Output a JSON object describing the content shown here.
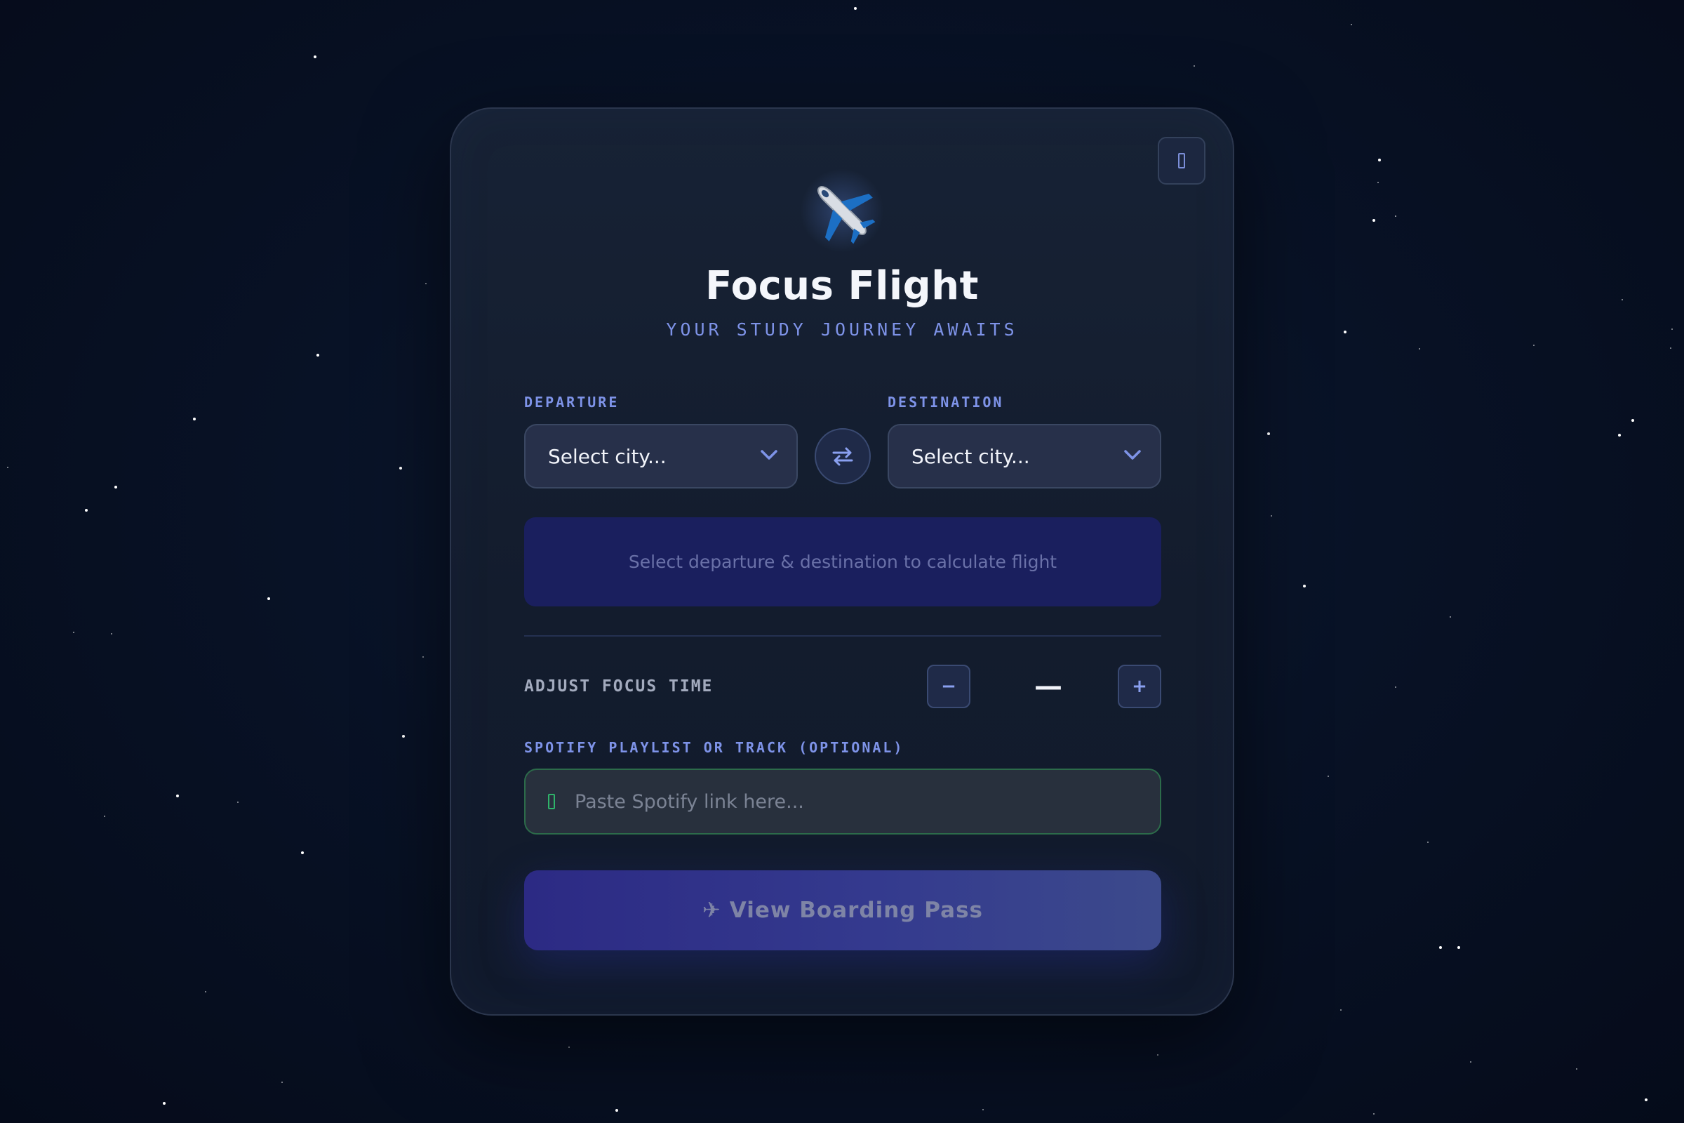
{
  "app": {
    "title": "Focus Flight",
    "subtitle": "YOUR STUDY JOURNEY AWAITS",
    "logo_icon": "airplane-icon",
    "corner_icon": "panel-icon"
  },
  "route": {
    "departure_label": "DEPARTURE",
    "departure_value": "Select city...",
    "destination_label": "DESTINATION",
    "destination_value": "Select city...",
    "swap_icon": "swap-arrows-icon",
    "info_text": "Select departure & destination to calculate flight"
  },
  "focus": {
    "label": "ADJUST FOCUS TIME",
    "decrement": "−",
    "increment": "+",
    "value": "—"
  },
  "spotify": {
    "label": "SPOTIFY PLAYLIST OR TRACK (OPTIONAL)",
    "placeholder": "Paste Spotify link here...",
    "value": ""
  },
  "cta": {
    "label": "✈ View Boarding Pass"
  },
  "colors": {
    "accent": "#7e93e8",
    "spotify_green": "#2fb36a",
    "background": "#081226",
    "card": "#141d2f"
  }
}
